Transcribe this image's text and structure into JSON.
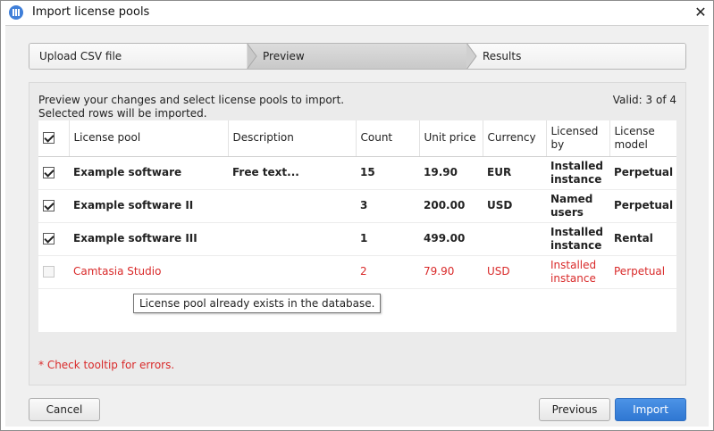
{
  "window": {
    "title": "Import license pools"
  },
  "steps": [
    "Upload CSV file",
    "Preview",
    "Results"
  ],
  "intro": {
    "line1": "Preview your changes and select license pools to import.",
    "line2": "Selected rows will be imported."
  },
  "valid": "Valid: 3 of 4",
  "table": {
    "header_checked": true,
    "columns": [
      "License pool",
      "Description",
      "Count",
      "Unit price",
      "Currency",
      "Licensed by",
      "License model"
    ],
    "rows": [
      {
        "checked": true,
        "error": false,
        "license_pool": "Example software",
        "description": "Free text...",
        "count": "15",
        "unit_price": "19.90",
        "currency": "EUR",
        "licensed_by": "Installed instance",
        "license_model": "Perpetual"
      },
      {
        "checked": true,
        "error": false,
        "license_pool": "Example software II",
        "description": "",
        "count": "3",
        "unit_price": "200.00",
        "currency": "USD",
        "licensed_by": "Named users",
        "license_model": "Perpetual"
      },
      {
        "checked": true,
        "error": false,
        "license_pool": "Example software III",
        "description": "",
        "count": "1",
        "unit_price": "499.00",
        "currency": "",
        "licensed_by": "Installed instance",
        "license_model": "Rental"
      },
      {
        "checked": false,
        "error": true,
        "license_pool": "Camtasia Studio",
        "description": "",
        "count": "2",
        "unit_price": "79.90",
        "currency": "USD",
        "licensed_by": "Installed instance",
        "license_model": "Perpetual"
      }
    ]
  },
  "tooltip": "License pool already exists in the database.",
  "error_note": "* Check tooltip for errors.",
  "buttons": {
    "cancel": "Cancel",
    "previous": "Previous",
    "import": "Import"
  },
  "colors": {
    "accent": "#2f77d2",
    "error": "#d92a2a",
    "active_step": "#d0d0d0"
  },
  "icons": {
    "app": "app-logo-icon",
    "close": "close-icon",
    "checkbox": "checkbox-icon"
  }
}
